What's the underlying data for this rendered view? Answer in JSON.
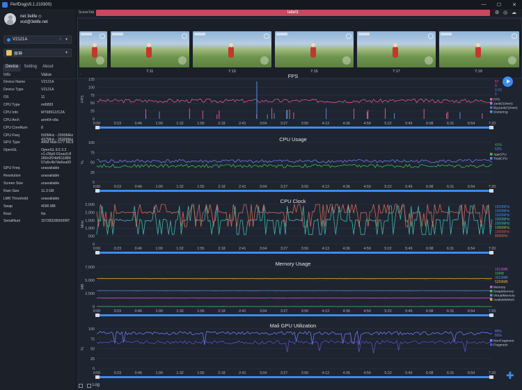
{
  "window": {
    "title": "PerfDog(v5.1.210300)",
    "min": "—",
    "max": "☐",
    "close": "✕"
  },
  "user": {
    "name": "net 3elife ◇",
    "email": "xcd@3elife.net"
  },
  "device_select": {
    "label": "V2121A",
    "icon": "wifi-icon"
  },
  "app_select": {
    "label": "原神"
  },
  "tabs": [
    "Device",
    "Setting",
    "About"
  ],
  "info_head": {
    "key": "Info",
    "value": "Value"
  },
  "info": [
    {
      "k": "Device Name",
      "v": "V2121A"
    },
    {
      "k": "Device Type",
      "v": "V2121A"
    },
    {
      "k": "OS",
      "v": "11"
    },
    {
      "k": "CPU Type",
      "v": "mt6893"
    },
    {
      "k": "CPU Info",
      "v": "MT6891Z/CZA"
    },
    {
      "k": "CPU Arch",
      "v": "arm64-v8a"
    },
    {
      "k": "CPU CoreNum",
      "v": "8"
    },
    {
      "k": "CPU Freq",
      "v": "500MHz - 2000MHz 437MHz - 2600MHz"
    },
    {
      "k": "GPU Type",
      "v": "ARM Mali-G77 MC9"
    },
    {
      "k": "OpenGL",
      "v": "OpenGL ES 3.2 v1.r26p0-01eac0.8 289c0f24bf511889 57a5c4b7de6ea00"
    },
    {
      "k": "GPU Freq",
      "v": "unavailable"
    },
    {
      "k": "Resolution",
      "v": "unavailable"
    },
    {
      "k": "Screen Size",
      "v": "unavailable"
    },
    {
      "k": "Ram Size",
      "v": "11.3 GB"
    },
    {
      "k": "LMK Threshold",
      "v": "unavailable"
    },
    {
      "k": "Swap",
      "v": "4096 MB"
    },
    {
      "k": "Root",
      "v": "No"
    },
    {
      "k": "SerialNum",
      "v": "157283280500RT"
    }
  ],
  "scene": {
    "tab_label": "SceneTab",
    "label": "label1"
  },
  "thumbnails": [
    "7:11",
    "7:13",
    "7:15",
    "7:17",
    "7:19"
  ],
  "time_ticks": [
    "0:00",
    "0:23",
    "0:46",
    "1:09",
    "1:32",
    "1:55",
    "2:18",
    "2:41",
    "3:04",
    "3:27",
    "3:50",
    "4:13",
    "4:36",
    "4:59",
    "5:22",
    "5:45",
    "6:08",
    "6:31",
    "6:54",
    "7:20"
  ],
  "bottom": {
    "log_label": "Log"
  },
  "chart_data": [
    {
      "type": "line",
      "title": "FPS",
      "ylabel": "FPS",
      "ylim": [
        0,
        125
      ],
      "yticks": [
        "0",
        "25",
        "50",
        "75",
        "100",
        "125"
      ],
      "legend_values": [
        {
          "text": "57",
          "color": "#e05a9b"
        },
        {
          "text": "0",
          "color": "#e05a9b"
        },
        {
          "text": "0.00",
          "color": "#5b7be0"
        },
        {
          "text": "0",
          "color": "#5b7be0"
        }
      ],
      "legend": [
        {
          "name": "FPS",
          "color": "#e05a9b"
        },
        {
          "name": "Jank(/10min)",
          "color": "#7b8bd8"
        },
        {
          "name": "BigJank(/10min)",
          "color": "#5b6be0"
        },
        {
          "name": "Stuttering",
          "color": "#5b9be0"
        }
      ],
      "series": [
        {
          "name": "FPS",
          "color": "#e05a9b",
          "mean": 57,
          "values": []
        }
      ]
    },
    {
      "type": "line",
      "title": "CPU Usage",
      "ylabel": "%",
      "ylim": [
        0,
        100
      ],
      "yticks": [
        "0",
        "25",
        "50",
        "75",
        "100"
      ],
      "legend_values": [
        {
          "text": "41%",
          "color": "#3fbf60"
        },
        {
          "text": "53%",
          "color": "#6f7ef0"
        }
      ],
      "legend": [
        {
          "name": "AppCPU",
          "color": "#3fbf60"
        },
        {
          "name": "TotalCPU",
          "color": "#6f7ef0"
        }
      ],
      "series": [
        {
          "name": "AppCPU",
          "color": "#3fbf60",
          "mean": 41
        },
        {
          "name": "TotalCPU",
          "color": "#6f7ef0",
          "mean": 53
        }
      ]
    },
    {
      "type": "line",
      "title": "CPU Clock",
      "ylabel": "MHz",
      "ylim": [
        0,
        2500
      ],
      "yticks": [
        "0",
        "500",
        "1,000",
        "1,500",
        "2,000",
        "2,500"
      ],
      "legend_values": [
        {
          "text": "1500MHz",
          "color": "#3b8cf0"
        },
        {
          "text": "1500MHz",
          "color": "#3b8cf0"
        },
        {
          "text": "1500MHz",
          "color": "#3b8cf0"
        },
        {
          "text": "1500MHz",
          "color": "#3fbfbf"
        },
        {
          "text": "1500MHz",
          "color": "#3fbfbf"
        },
        {
          "text": "1990MHz",
          "color": "#9fbf3f"
        },
        {
          "text": "1995MHz",
          "color": "#d05050"
        },
        {
          "text": "806MHz",
          "color": "#d07050"
        }
      ],
      "legend": [],
      "series": [
        {
          "name": "CPU0-5",
          "color": "#3fb8b0",
          "mean": 1500
        },
        {
          "name": "CPU6-7",
          "color": "#d06a58",
          "mean": 1990
        }
      ]
    },
    {
      "type": "line",
      "title": "Memory Usage",
      "ylabel": "MB",
      "ylim": [
        0,
        7500
      ],
      "yticks": [
        "0",
        "2,500",
        "5,000",
        "7,500"
      ],
      "legend_values": [
        {
          "text": "1613MB",
          "color": "#c85ad8"
        },
        {
          "text": "10MB",
          "color": "#3fbf60"
        },
        {
          "text": "3013MB",
          "color": "#5b8be0"
        },
        {
          "text": "5299MB",
          "color": "#e0b030"
        }
      ],
      "legend": [
        {
          "name": "Memory",
          "color": "#c85ad8"
        },
        {
          "name": "SwapMemory",
          "color": "#3fbf60"
        },
        {
          "name": "VirtualMemory",
          "color": "#5b8be0"
        },
        {
          "name": "AvailableMem",
          "color": "#e0b030"
        }
      ],
      "series": [
        {
          "name": "Memory",
          "color": "#c85ad8",
          "mean": 1613
        },
        {
          "name": "SwapMemory",
          "color": "#3fbf60",
          "mean": 10
        },
        {
          "name": "VirtualMemory",
          "color": "#5b8be0",
          "mean": 3013
        },
        {
          "name": "AvailableMem",
          "color": "#e0b030",
          "mean": 5299
        }
      ]
    },
    {
      "type": "line",
      "title": "Mali GPU Utilization",
      "ylabel": "%",
      "ylim": [
        0,
        100
      ],
      "yticks": [
        "0",
        "25",
        "50",
        "75",
        "100"
      ],
      "legend_values": [
        {
          "text": "89%",
          "color": "#6f7ef0"
        },
        {
          "text": "66%",
          "color": "#6f7ef0"
        }
      ],
      "legend": [
        {
          "name": "NonFragment",
          "color": "#6f7ef0"
        },
        {
          "name": "Fragment",
          "color": "#5a50c8"
        }
      ],
      "series": [
        {
          "name": "NonFragment",
          "color": "#6f7ef0",
          "mean": 89
        },
        {
          "name": "Fragment",
          "color": "#5a50c8",
          "mean": 66
        }
      ]
    }
  ]
}
